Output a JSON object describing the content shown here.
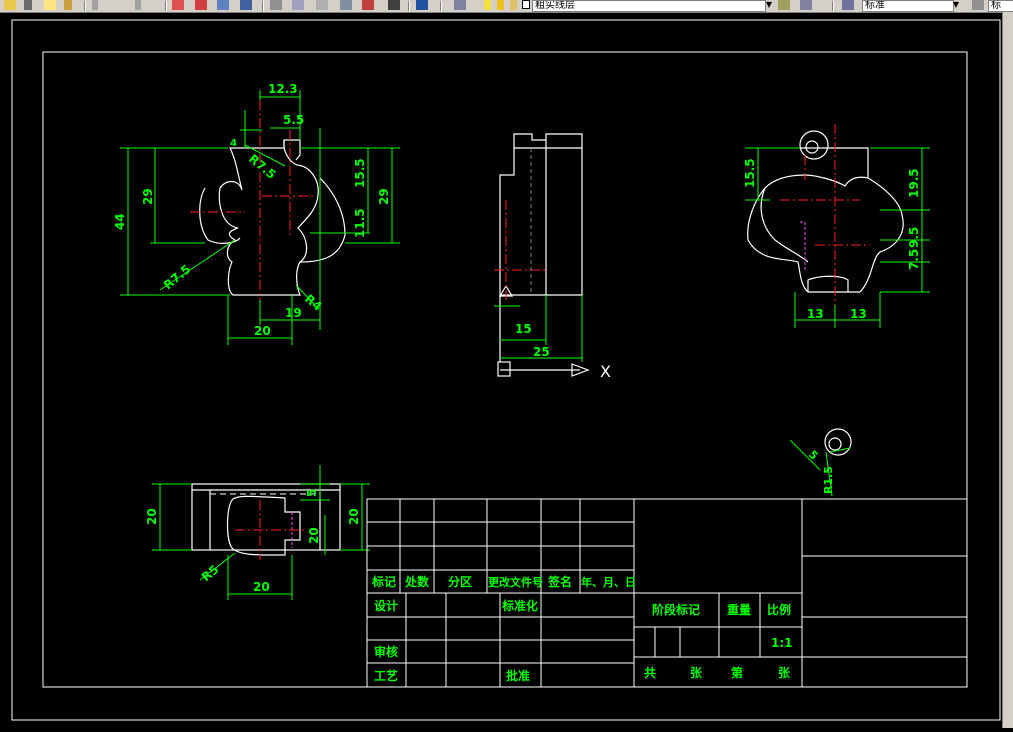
{
  "toolbar": {
    "layer_name": "粗实线层",
    "style_name": "标准",
    "right_clip_text": "标"
  },
  "drawing": {
    "front_view": {
      "dims": {
        "d12_3": "12.3",
        "d5_5": "5.5",
        "d4": "4",
        "d29_left": "29",
        "d44": "44",
        "d15_5": "15.5",
        "d29_right": "29",
        "d11_5": "11.5",
        "r7_5_top": "R7.5",
        "r7_5_bottom": "R7.5",
        "r4": "R4",
        "d20": "20",
        "d19": "19"
      }
    },
    "side_view": {
      "dims": {
        "d15": "15",
        "d25": "25"
      },
      "axis_x": "X"
    },
    "right_view": {
      "dims": {
        "d15_5": "15.5",
        "d19_5": "19.5",
        "d9_5": "9.5",
        "d7_5": "7.5",
        "d13_left": "13",
        "d13_right": "13"
      }
    },
    "detail": {
      "dims": {
        "d5": "5",
        "r1_5": "R1.5"
      }
    },
    "bottom_view": {
      "dims": {
        "d20_left": "20",
        "d5": "5",
        "d20_mid": "20",
        "d20_right": "20",
        "r5": "R5",
        "d20_bottom": "20"
      }
    }
  },
  "title_block": {
    "headers": {
      "biaoji": "标记",
      "chushu": "处数",
      "fenqu": "分区",
      "gengai": "更改文件号",
      "qianming": "签名",
      "nianyueri": "年、月、日"
    },
    "rows": {
      "sheji": "设计",
      "biaozhunhua": "标准化",
      "shenhe": "审核",
      "gongyi": "工艺",
      "pizhun": "批准"
    },
    "stage": {
      "jieduan": "阶段标记",
      "zhongliang": "重量",
      "bili": "比例",
      "scale_value": "1:1"
    },
    "sheets": {
      "gong": "共",
      "zhang1": "张",
      "di": "第",
      "zhang2": "张"
    }
  }
}
